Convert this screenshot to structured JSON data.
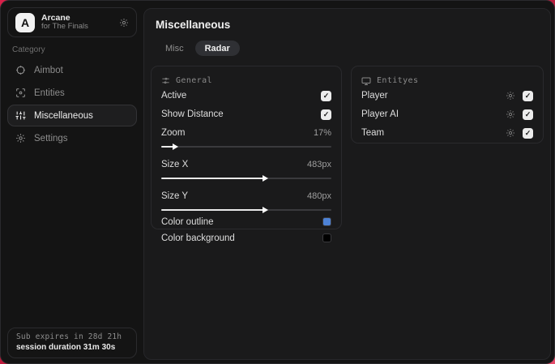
{
  "colors": {
    "accent_red_bg": "#b21737",
    "outline_swatch": "#4d82d6",
    "background_swatch": "#000000"
  },
  "sidebar": {
    "app": {
      "logo_letter": "A",
      "name": "Arcane",
      "subtitle": "for The Finals",
      "gear_icon": "gear-icon"
    },
    "category_label": "Category",
    "items": [
      {
        "label": "Aimbot",
        "icon": "crosshair-icon",
        "selected": false
      },
      {
        "label": "Entities",
        "icon": "scan-icon",
        "selected": false
      },
      {
        "label": "Miscellaneous",
        "icon": "sliders-icon",
        "selected": true
      },
      {
        "label": "Settings",
        "icon": "gear-icon",
        "selected": false
      }
    ],
    "footer": {
      "line1": "Sub expires in 28d 21h",
      "line2": "session duration 31m 30s"
    }
  },
  "main": {
    "title": "Miscellaneous",
    "tabs": [
      {
        "label": "Misc",
        "active": false
      },
      {
        "label": "Radar",
        "active": true
      }
    ],
    "general": {
      "header": "General",
      "header_icon": "sliders-horizontal-icon",
      "active_label": "Active",
      "active_checked": true,
      "show_distance_label": "Show Distance",
      "show_distance_checked": true,
      "zoom_label": "Zoom",
      "zoom_value": "17%",
      "zoom_fill": "7%",
      "size_x_label": "Size X",
      "size_x_value": "483px",
      "size_x_fill": "60%",
      "size_y_label": "Size Y",
      "size_y_value": "480px",
      "size_y_fill": "60%",
      "color_outline_label": "Color outline",
      "color_outline_value": "#4d82d6",
      "color_background_label": "Color background",
      "color_background_value": "#000000"
    },
    "entities": {
      "header": "Entityes",
      "header_icon": "monitor-icon",
      "rows": [
        {
          "label": "Player",
          "checked": true,
          "gear_icon": "gear-icon"
        },
        {
          "label": "Player AI",
          "checked": true,
          "gear_icon": "gear-icon"
        },
        {
          "label": "Team",
          "checked": true,
          "gear_icon": "gear-icon"
        }
      ]
    }
  }
}
